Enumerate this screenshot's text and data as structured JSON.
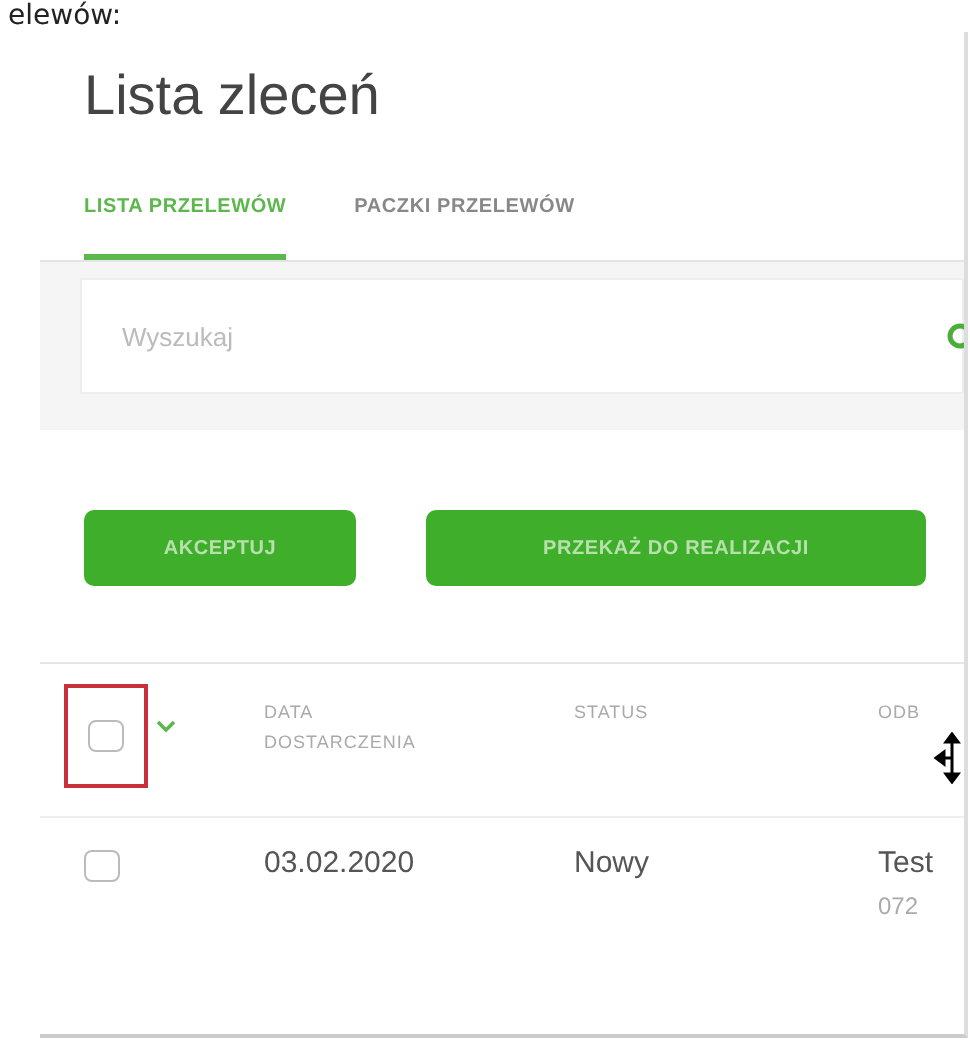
{
  "caption": "elewów:",
  "title": "Lista zleceń",
  "tabs": [
    {
      "label": "LISTA PRZELEWÓW",
      "selected": true
    },
    {
      "label": "PACZKI PRZELEWÓW",
      "selected": false
    }
  ],
  "search": {
    "placeholder": "Wyszukaj"
  },
  "buttons": [
    "AKCEPTUJ",
    "PRZEKAŻ DO REALIZACJI"
  ],
  "table": {
    "select_all": {
      "checked": false,
      "highlighted": true
    },
    "columns": [
      "DATA DOSTARCZENIA",
      "STATUS",
      "ODB"
    ],
    "rows": [
      {
        "checked": false,
        "cells": [
          "03.02.2020",
          "Nowy",
          "Test"
        ],
        "subtext": "072"
      }
    ]
  }
}
